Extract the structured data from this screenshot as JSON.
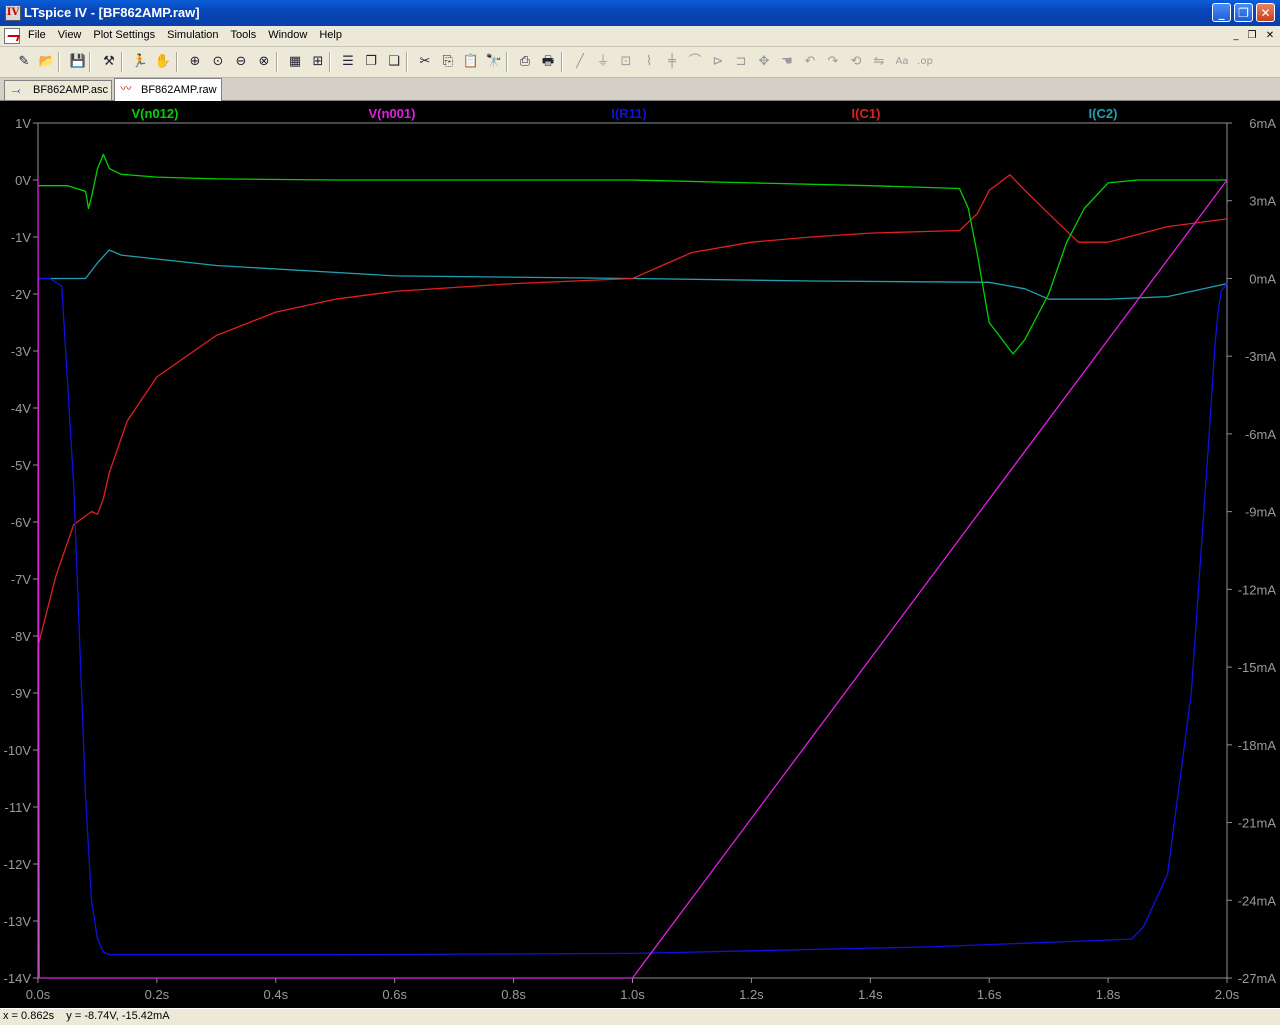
{
  "window": {
    "title": "LTspice IV - [BF862AMP.raw]",
    "app_icon": "ltspice-icon"
  },
  "menu": {
    "items": [
      {
        "label": "File"
      },
      {
        "label": "View"
      },
      {
        "label": "Plot Settings"
      },
      {
        "label": "Simulation"
      },
      {
        "label": "Tools"
      },
      {
        "label": "Window"
      },
      {
        "label": "Help"
      }
    ]
  },
  "toolbar": {
    "buttons": [
      {
        "name": "new-schematic-icon",
        "glyph": "✎"
      },
      {
        "name": "open-icon",
        "glyph": "📂"
      },
      {
        "name": "save-icon",
        "glyph": "💾"
      },
      {
        "name": "control-panel-icon",
        "glyph": "⚒"
      },
      {
        "name": "run-icon",
        "glyph": "🏃"
      },
      {
        "name": "halt-icon",
        "glyph": "✋"
      },
      {
        "name": "zoom-in-icon",
        "glyph": "⊕"
      },
      {
        "name": "zoom-pan-icon",
        "glyph": "⊙"
      },
      {
        "name": "zoom-out-icon",
        "glyph": "⊖"
      },
      {
        "name": "zoom-cancel-icon",
        "glyph": "⊗"
      },
      {
        "name": "autorange-icon",
        "glyph": "▦"
      },
      {
        "name": "zoom-extents-icon",
        "glyph": "⊞"
      },
      {
        "name": "tile-horizontal-icon",
        "glyph": "☰"
      },
      {
        "name": "cascade-icon",
        "glyph": "❐"
      },
      {
        "name": "tile-vertical-icon",
        "glyph": "❏"
      },
      {
        "name": "cut-icon",
        "glyph": "✂"
      },
      {
        "name": "copy-icon",
        "glyph": "⎘"
      },
      {
        "name": "paste-icon",
        "glyph": "📋"
      },
      {
        "name": "find-icon",
        "glyph": "🔭"
      },
      {
        "name": "print-preview-icon",
        "glyph": "⎙"
      },
      {
        "name": "print-icon",
        "glyph": "🖶"
      },
      {
        "name": "wire-icon",
        "glyph": "╱"
      },
      {
        "name": "ground-icon",
        "glyph": "⏚"
      },
      {
        "name": "label-net-icon",
        "glyph": "⊡"
      },
      {
        "name": "resistor-icon",
        "glyph": "⌇"
      },
      {
        "name": "capacitor-icon",
        "glyph": "╪"
      },
      {
        "name": "inductor-icon",
        "glyph": "⌒"
      },
      {
        "name": "diode-icon",
        "glyph": "⊳"
      },
      {
        "name": "component-icon",
        "glyph": "⊐"
      },
      {
        "name": "move-icon",
        "glyph": "✥"
      },
      {
        "name": "drag-icon",
        "glyph": "☚"
      },
      {
        "name": "undo-icon",
        "glyph": "↶"
      },
      {
        "name": "redo-icon",
        "glyph": "↷"
      },
      {
        "name": "rotate-icon",
        "glyph": "⟲"
      },
      {
        "name": "mirror-icon",
        "glyph": "⇋"
      },
      {
        "name": "text-icon",
        "glyph": "Aa"
      },
      {
        "name": "spice-directive-icon",
        "glyph": ".op"
      }
    ]
  },
  "tabs": [
    {
      "label": "BF862AMP.asc",
      "icon": "schematic-icon"
    },
    {
      "label": "BF862AMP.raw",
      "icon": "waveform-icon",
      "active": true
    }
  ],
  "status": {
    "text": "x = 0.862s    y = -8.74V, -15.42mA"
  },
  "chart_data": {
    "type": "line",
    "background": "#000000",
    "grid": false,
    "xlabel": "",
    "ylabel": "",
    "xlim": [
      0,
      2.0
    ],
    "ylim_left": [
      -14,
      1
    ],
    "ylim_right": [
      -27,
      6
    ],
    "x_ticks": [
      "0.0s",
      "0.2s",
      "0.4s",
      "0.6s",
      "0.8s",
      "1.0s",
      "1.2s",
      "1.4s",
      "1.6s",
      "1.8s",
      "2.0s"
    ],
    "y_left_ticks": [
      "1V",
      "0V",
      "-1V",
      "-2V",
      "-3V",
      "-4V",
      "-5V",
      "-6V",
      "-7V",
      "-8V",
      "-9V",
      "-10V",
      "-11V",
      "-12V",
      "-13V",
      "-14V"
    ],
    "y_right_ticks": [
      "6mA",
      "3mA",
      "0mA",
      "-3mA",
      "-6mA",
      "-9mA",
      "-12mA",
      "-15mA",
      "-18mA",
      "-21mA",
      "-24mA",
      "-27mA"
    ],
    "series": [
      {
        "name": "V(n012)",
        "color": "#00d000",
        "axis": "left",
        "x": [
          0,
          0.05,
          0.08,
          0.085,
          0.09,
          0.1,
          0.11,
          0.12,
          0.14,
          0.2,
          0.3,
          0.5,
          1.0,
          1.2,
          1.4,
          1.55,
          1.565,
          1.58,
          1.6,
          1.64,
          1.66,
          1.7,
          1.73,
          1.76,
          1.8,
          1.85,
          1.9,
          2.0
        ],
        "y": [
          -0.1,
          -0.1,
          -0.2,
          -0.5,
          -0.3,
          0.2,
          0.45,
          0.2,
          0.1,
          0.05,
          0.02,
          0.0,
          0.0,
          -0.05,
          -0.1,
          -0.15,
          -0.5,
          -1.3,
          -2.5,
          -3.05,
          -2.8,
          -2.0,
          -1.1,
          -0.5,
          -0.05,
          0.0,
          0.0,
          0.0
        ]
      },
      {
        "name": "V(n001)",
        "color": "#e020e0",
        "axis": "left",
        "x": [
          0,
          0.002,
          0.005,
          1.0,
          2.0
        ],
        "y": [
          0.0,
          -14.0,
          -14.0,
          -14.0,
          0.0
        ]
      },
      {
        "name": "I(R11)",
        "color": "#1010e0",
        "axis": "right",
        "x": [
          0,
          0.02,
          0.04,
          0.06,
          0.08,
          0.09,
          0.1,
          0.11,
          0.12,
          0.13,
          0.2,
          0.5,
          1.0,
          1.5,
          1.84,
          1.86,
          1.9,
          1.94,
          1.97,
          1.98,
          1.985,
          1.99,
          2.0
        ],
        "y": [
          0.0,
          0.0,
          -0.3,
          -8.0,
          -20.0,
          -24.0,
          -25.5,
          -26.0,
          -26.1,
          -26.1,
          -26.1,
          -26.1,
          -26.05,
          -25.8,
          -25.5,
          -25.0,
          -23.0,
          -16.0,
          -6.0,
          -2.5,
          -1.3,
          -0.5,
          -0.2
        ]
      },
      {
        "name": "I(C1)",
        "color": "#e02020",
        "axis": "right",
        "x": [
          0,
          0.03,
          0.06,
          0.09,
          0.1,
          0.11,
          0.12,
          0.15,
          0.2,
          0.3,
          0.4,
          0.5,
          0.6,
          0.8,
          1.0,
          1.05,
          1.1,
          1.2,
          1.3,
          1.4,
          1.55,
          1.58,
          1.6,
          1.635,
          1.66,
          1.7,
          1.75,
          1.8,
          1.85,
          1.9,
          2.0
        ],
        "y": [
          -14.2,
          -11.5,
          -9.5,
          -9.0,
          -9.1,
          -8.5,
          -7.5,
          -5.5,
          -3.8,
          -2.2,
          -1.3,
          -0.8,
          -0.5,
          -0.2,
          0.0,
          0.5,
          1.0,
          1.4,
          1.6,
          1.75,
          1.85,
          2.5,
          3.4,
          4.0,
          3.4,
          2.5,
          1.4,
          1.4,
          1.7,
          2.0,
          2.3
        ]
      },
      {
        "name": "I(C2)",
        "color": "#20a0b0",
        "axis": "right",
        "x": [
          0,
          0.08,
          0.1,
          0.12,
          0.14,
          0.3,
          0.6,
          1.0,
          1.3,
          1.6,
          1.66,
          1.7,
          1.8,
          1.9,
          2.0
        ],
        "y": [
          0.0,
          0.0,
          0.6,
          1.1,
          0.9,
          0.5,
          0.1,
          0.0,
          -0.1,
          -0.15,
          -0.4,
          -0.8,
          -0.8,
          -0.7,
          -0.2
        ]
      }
    ]
  }
}
